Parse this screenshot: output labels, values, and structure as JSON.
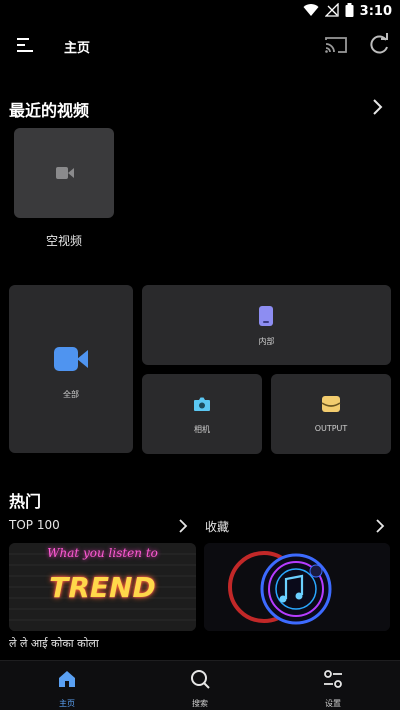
{
  "status_bar": {
    "time": "3:10"
  },
  "app_bar": {
    "title": "主页"
  },
  "recent": {
    "title": "最近的视频",
    "item_caption": "空视频"
  },
  "categories": {
    "all": "全部",
    "internal": "内部",
    "camera": "相机",
    "output": "OUTPUT"
  },
  "hot": {
    "title": "热门",
    "left_label": "TOP 100",
    "right_label": "收藏",
    "banner_line1": "What you listen to",
    "banner_line2": "TREND",
    "song_title": "ले ले आई कोका कोला"
  },
  "bottom_nav": {
    "home": "主页",
    "search": "搜索",
    "settings": "设置"
  },
  "colors": {
    "accent": "#5aa0f2",
    "internal_icon": "#8d8df2",
    "camera_icon": "#5bc7f2",
    "output_icon": "#f2cc6e"
  }
}
